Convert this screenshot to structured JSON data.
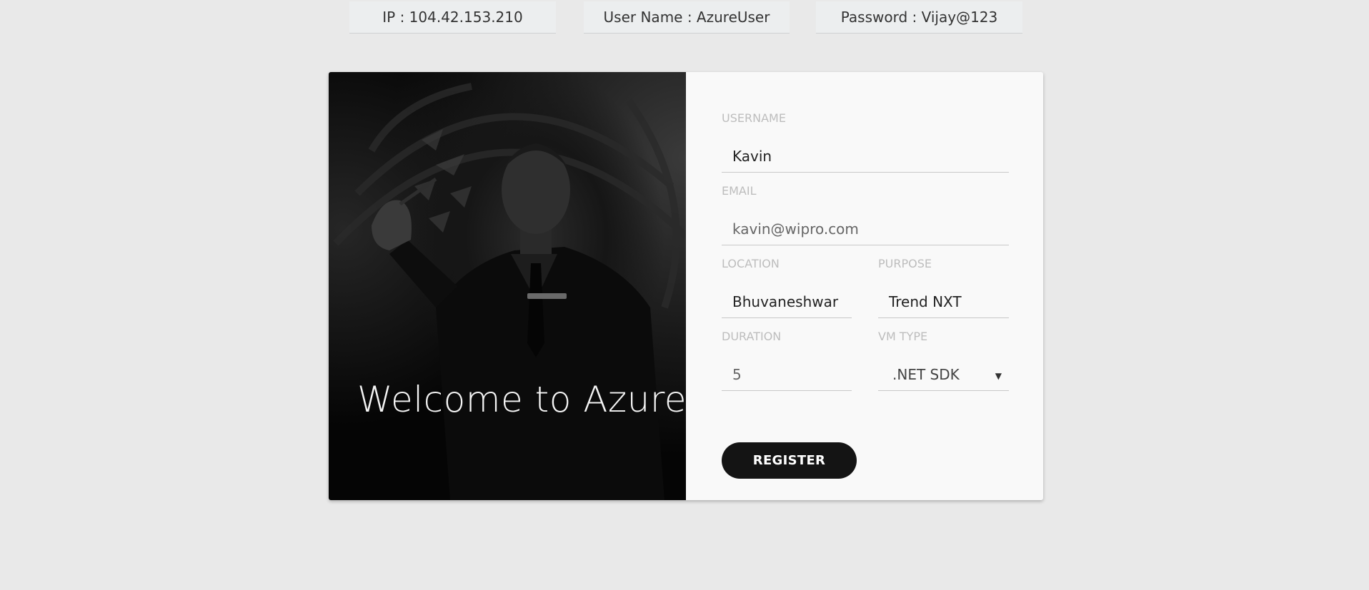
{
  "credentials": {
    "ip": "IP : 104.42.153.210",
    "username": "User Name : AzureUser",
    "password": "Password : Vijay@123"
  },
  "hero": {
    "title": "Welcome to Azure"
  },
  "form": {
    "username": {
      "label": "USERNAME",
      "value": "Kavin"
    },
    "email": {
      "label": "EMAIL",
      "value": "kavin@wipro.com"
    },
    "location": {
      "label": "LOCATION",
      "value": "Bhuvaneshwar"
    },
    "purpose": {
      "label": "PURPOSE",
      "value": "Trend NXT"
    },
    "duration": {
      "label": "DURATION",
      "value": "5"
    },
    "vm_type": {
      "label": "VM TYPE",
      "selected": ".NET SDK"
    },
    "register_label": "REGISTER"
  },
  "colors": {
    "page_background": "#e9e9e9",
    "form_background": "#f9f9f9",
    "button_background": "#141414",
    "label_color": "#bdbdbd"
  }
}
